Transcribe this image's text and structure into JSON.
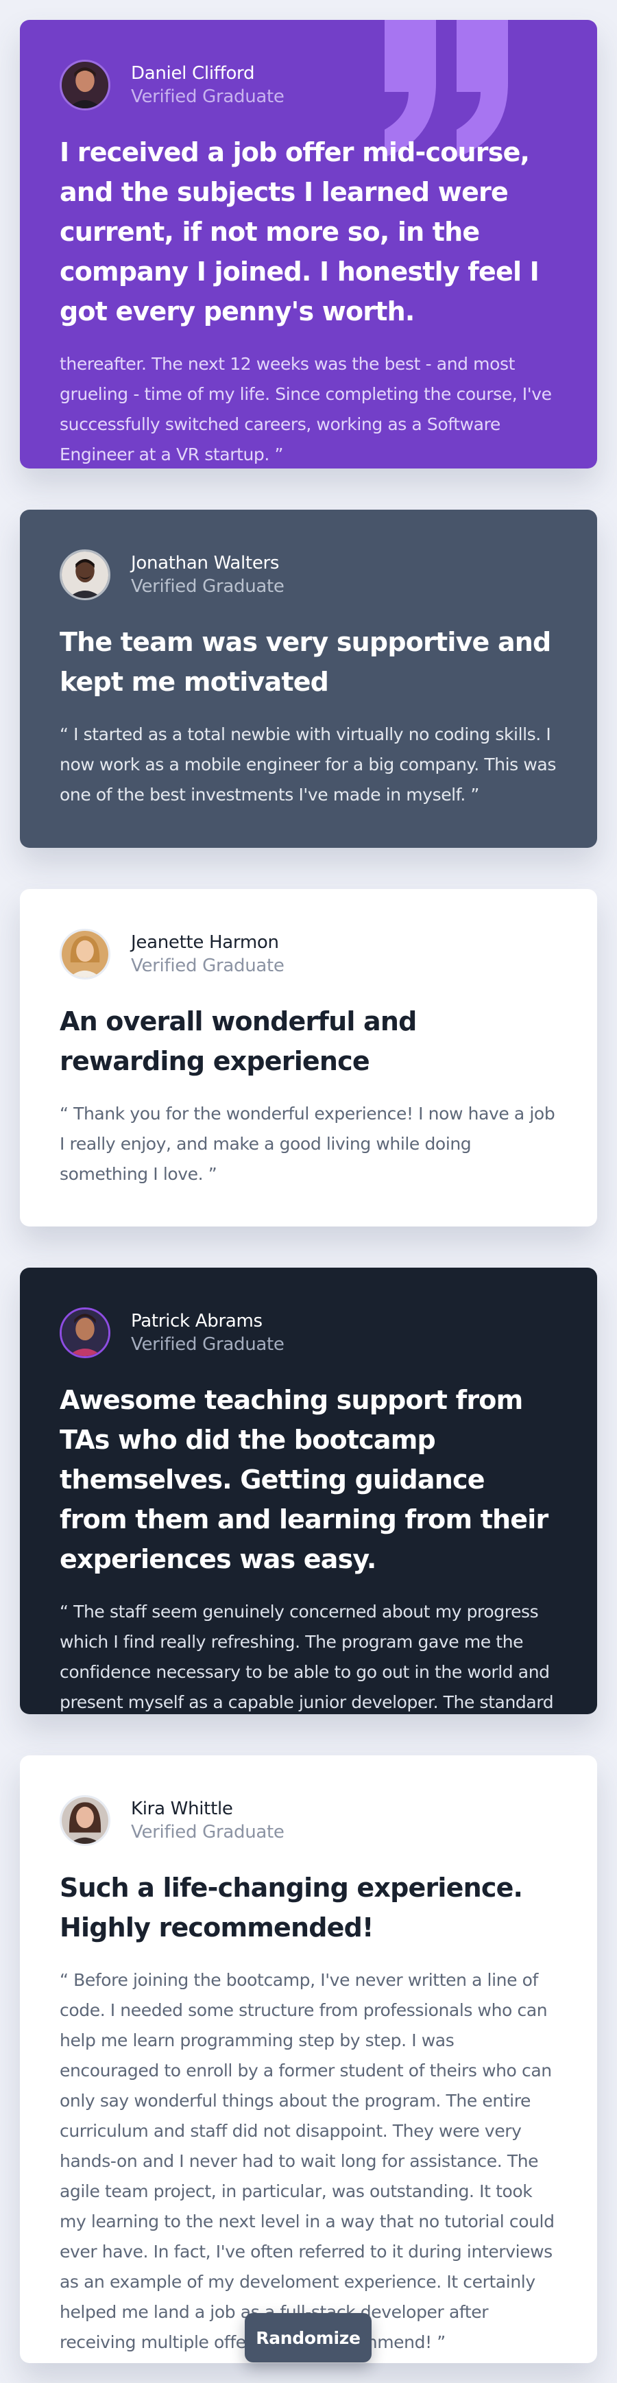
{
  "colors": {
    "page_background": "#eef0f7",
    "purple_card": "#733fc8",
    "slate_card": "#48556a",
    "white_card": "#ffffff",
    "navy_card": "#19212e",
    "button": "#48556a"
  },
  "testimonials": [
    {
      "icon": "quote-mark-icon",
      "name": "Daniel Clifford",
      "role": "Verified Graduate",
      "headline": "I received a job offer mid-course, and the subjects I learned were current, if not more so, in the company I joined. I honestly feel I got every penny's worth.",
      "body": "thereafter. The next 12 weeks was the best - and most grueling - time of my life. Since completing the course, I've successfully switched careers, working as a Software Engineer at a VR startup. ”"
    },
    {
      "name": "Jonathan Walters",
      "role": "Verified Graduate",
      "headline": "The team was very supportive and kept me motivated",
      "body": "“ I started as a total newbie with virtually no coding skills. I now work as a mobile engineer for a big company. This was one of the best investments I've made in myself. ”"
    },
    {
      "name": "Jeanette Harmon",
      "role": "Verified Graduate",
      "headline": "An overall wonderful and rewarding experience",
      "body": "“ Thank you for the wonderful experience! I now have a job I really enjoy, and make a good living while doing something I love. ”"
    },
    {
      "name": "Patrick Abrams",
      "role": "Verified Graduate",
      "headline": "Awesome teaching support from TAs who did the bootcamp themselves. Getting guidance from them and learning from their experiences was easy.",
      "body": "“ The staff seem genuinely concerned about my progress which I find really refreshing. The program gave me the confidence necessary to be able to go out in the world and present myself as a capable junior developer. The standard is above the rest. You"
    },
    {
      "name": "Kira Whittle",
      "role": "Verified Graduate",
      "headline": "Such a life-changing experience. Highly recommended!",
      "body": "“ Before joining the bootcamp, I've never written a line of code. I needed some structure from professionals who can help me learn programming step by step. I was encouraged to enroll by a former student of theirs who can only say wonderful things about the program. The entire curriculum and staff did not disappoint. They were very hands-on and I never had to wait long for assistance. The agile team project, in particular, was outstanding. It took my learning to the next level in a way that no tutorial could ever have. In fact, I've often referred to it during interviews as an example of my develoment experience. It certainly helped me land a job as a full-stack developer after receiving multiple offers. 100% recommend! ”"
    }
  ],
  "randomize_button": {
    "label": "Randomize"
  }
}
